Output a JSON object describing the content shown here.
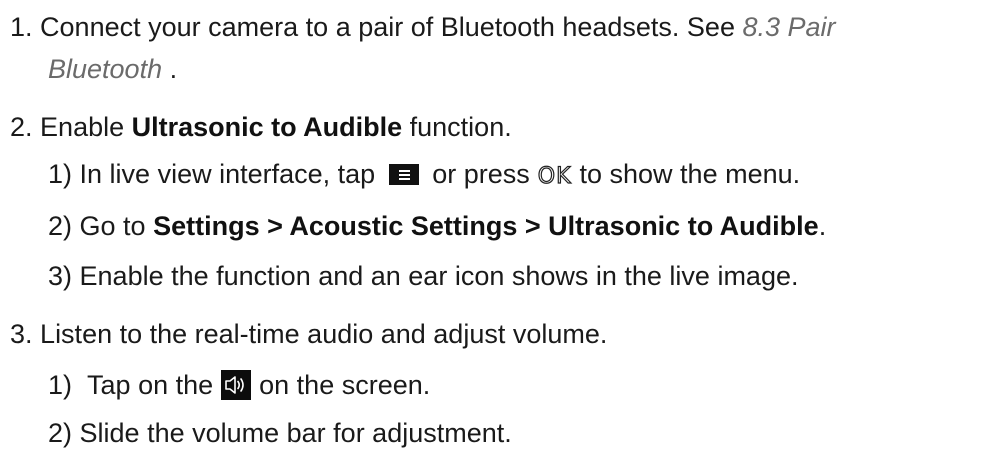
{
  "steps": [
    {
      "number": "1.",
      "text_a": "Connect your camera to a pair of Bluetooth headsets. See ",
      "link_a": "8.3 Pair",
      "link_b": "Bluetooth",
      "text_b": " ."
    },
    {
      "number": "2.",
      "text_a": "Enable ",
      "bold": "Ultrasonic to Audible",
      "text_b": " function.",
      "substeps": [
        {
          "number": "1)",
          "text_a": "In live view interface, tap ",
          "icon1": "menu-icon",
          "text_b": "or press",
          "icon2_glyph": "OK",
          "text_c": "to show the menu."
        },
        {
          "number": "2)",
          "text_a": "Go to ",
          "bold": "Settings > Acoustic Settings > Ultrasonic to Audible",
          "text_b": "."
        },
        {
          "number": "3)",
          "text": "Enable the function and an ear icon shows in the live image."
        }
      ]
    },
    {
      "number": "3.",
      "text": "Listen to the real-time audio and adjust volume.",
      "substeps": [
        {
          "number": "1)",
          "text_a": "Tap on the",
          "icon": "volume-icon",
          "text_b": "on the screen."
        },
        {
          "number": "2)",
          "text": "Slide the volume bar for adjustment."
        }
      ]
    }
  ]
}
